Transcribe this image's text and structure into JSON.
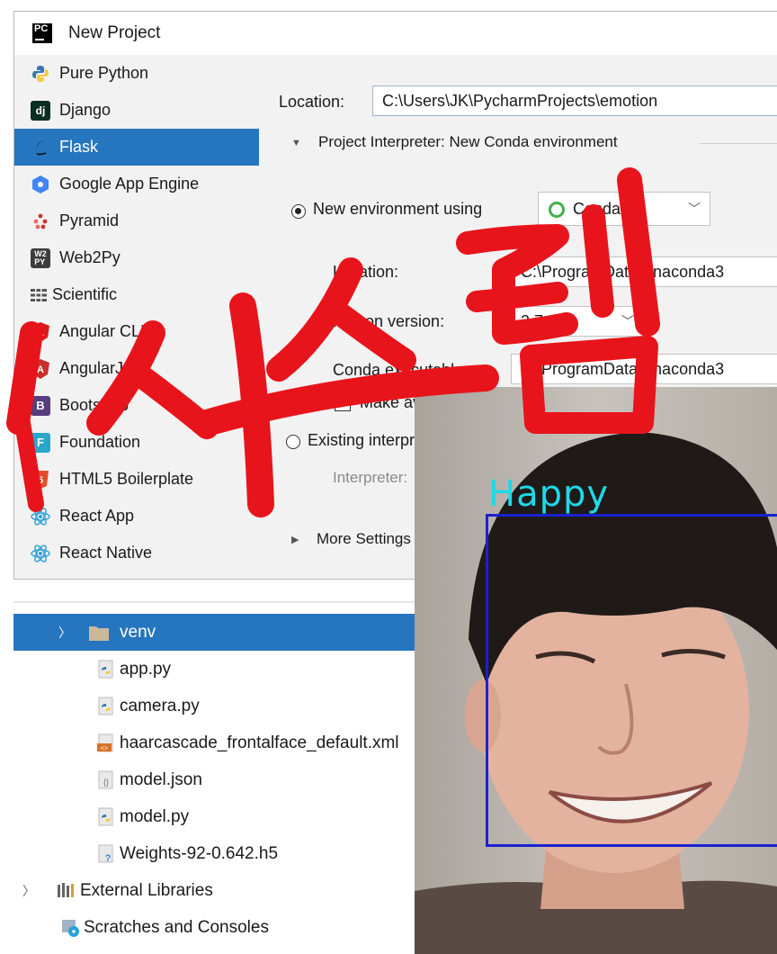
{
  "dialog": {
    "title": "New Project",
    "sidebar": {
      "items": [
        {
          "label": "Pure Python",
          "icon": "python-icon"
        },
        {
          "label": "Django",
          "icon": "django-icon"
        },
        {
          "label": "Flask",
          "icon": "flask-icon",
          "selected": true
        },
        {
          "label": "Google App Engine",
          "icon": "google-app-engine-icon"
        },
        {
          "label": "Pyramid",
          "icon": "pyramid-icon"
        },
        {
          "label": "Web2Py",
          "icon": "web2py-icon"
        },
        {
          "label": "Scientific",
          "icon": "scientific-icon"
        },
        {
          "label": "Angular CLI",
          "icon": "angular-cli-icon"
        },
        {
          "label": "AngularJS",
          "icon": "angularjs-icon"
        },
        {
          "label": "Bootstrap",
          "icon": "bootstrap-icon"
        },
        {
          "label": "Foundation",
          "icon": "foundation-icon"
        },
        {
          "label": "HTML5 Boilerplate",
          "icon": "html5-icon"
        },
        {
          "label": "React App",
          "icon": "react-icon"
        },
        {
          "label": "React Native",
          "icon": "react-icon"
        }
      ]
    },
    "form": {
      "location_label": "Location:",
      "location_value": "C:\\Users\\JK\\PycharmProjects\\emotion",
      "interpreter_section": "Project Interpreter: New Conda environment",
      "new_env_label": "New environment using",
      "env_tool": "Conda",
      "env_location_label": "Location:",
      "env_location_value": "C:\\ProgramData\\Anaconda3",
      "python_version_label": "Python version:",
      "python_version_value": "3.7",
      "conda_exec_label": "Conda executable:",
      "conda_exec_value": "C:\\ProgramData\\Anaconda3",
      "make_available_label": "Make available to all projects",
      "existing_interpreter_label": "Existing interpreter",
      "interpreter_label": "Interpreter:",
      "more_settings_label": "More Settings"
    }
  },
  "tree": {
    "rows": [
      {
        "label": "venv",
        "type": "folder",
        "selected": true
      },
      {
        "label": "app.py",
        "type": "python"
      },
      {
        "label": "camera.py",
        "type": "python"
      },
      {
        "label": "haarcascade_frontalface_default.xml",
        "type": "xml"
      },
      {
        "label": "model.json",
        "type": "json"
      },
      {
        "label": "model.py",
        "type": "python"
      },
      {
        "label": "Weights-92-0.642.h5",
        "type": "unknown"
      },
      {
        "label": "External Libraries",
        "type": "libraries"
      },
      {
        "label": "Scratches and Consoles",
        "type": "scratches"
      }
    ]
  },
  "camera": {
    "emotion": "Happy"
  },
  "overlay_text": "시스템",
  "colors": {
    "selection": "#2675bf",
    "brush_red": "#e8141b",
    "emotion_text": "#1fd8e8",
    "face_box": "#1a22d0"
  }
}
